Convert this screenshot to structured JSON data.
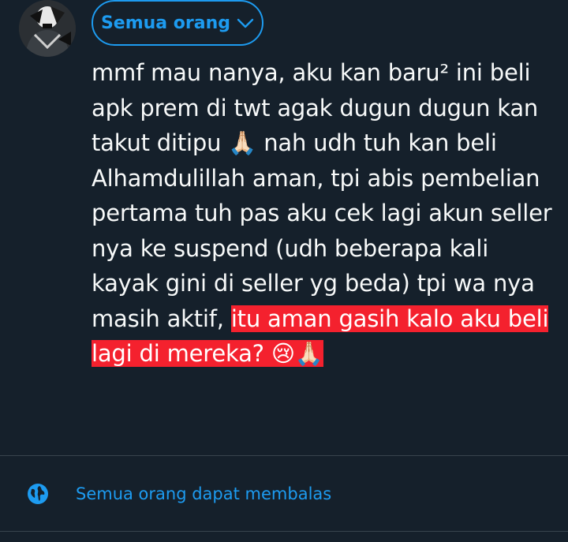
{
  "audience": {
    "label": "Semua orang"
  },
  "tweet": {
    "lines": [
      "mmf mau nanya, aku kan baru² ini beli",
      "apk prem di twt agak dugun dugun kan",
      "takut ditipu 🙏🏻 nah udh tuh kan beli",
      "Alhamdulillah aman, tpi abis pembelian",
      "pertama tuh pas aku cek lagi akun seller",
      "nya ke suspend (udh beberapa kali",
      "kayak gini di seller yg beda) tpi wa nya"
    ],
    "line8_plain": "masih aktif, ",
    "line8_highlight": "itu aman gasih kalo aku beli",
    "line9_highlight": "lagi di mereka? 😢🙏🏻"
  },
  "reply_setting": {
    "label": "Semua orang dapat membalas",
    "icon": "globe-icon"
  },
  "colors": {
    "background": "#15202b",
    "accent": "#1d9bf0",
    "highlight": "#f4212e",
    "text": "#f7f9f9",
    "divider": "#38444d"
  }
}
